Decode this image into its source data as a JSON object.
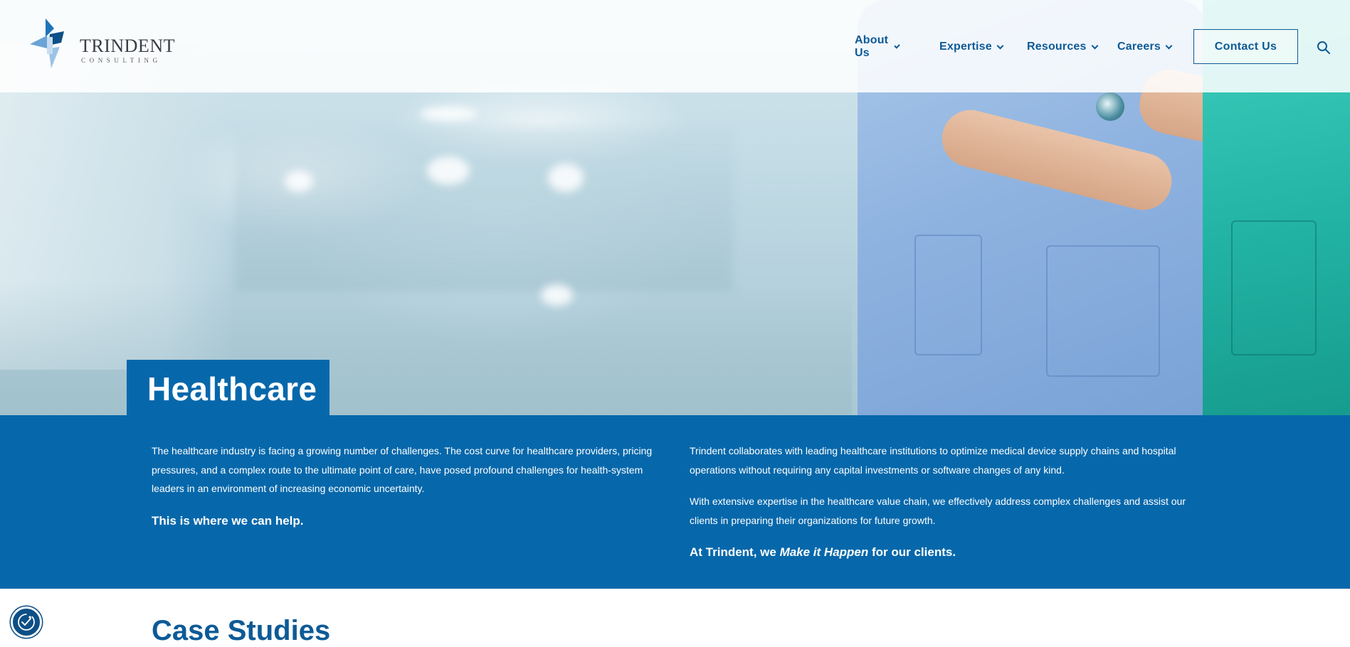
{
  "brand": {
    "name": "TRINDENT",
    "tagline": "CONSULTING",
    "primary_color": "#0668ab",
    "nav_color": "#0d5a96"
  },
  "nav": {
    "items": [
      {
        "label": "About Us",
        "icon": "chevron-down-icon"
      },
      {
        "label": "Expertise",
        "icon": "chevron-down-icon"
      },
      {
        "label": "Resources",
        "icon": "chevron-down-icon"
      },
      {
        "label": "Careers",
        "icon": "chevron-down-icon"
      }
    ],
    "contact_label": "Contact Us",
    "search_icon": "search-icon"
  },
  "hero": {
    "title": "Healthcare"
  },
  "intro": {
    "left_paragraph": "The healthcare industry is facing a growing number of challenges. The cost curve for healthcare providers, pricing pressures, and a complex route to the ultimate point of care, have posed profound challenges for health-system leaders in an environment of increasing economic uncertainty.",
    "left_lead": "This is where we can help.",
    "right_paragraph_1": "Trindent collaborates with leading healthcare institutions to optimize medical device supply chains and hospital operations without requiring any capital investments or software changes of any kind.",
    "right_paragraph_2": "With extensive expertise in the healthcare value chain, we effectively address complex challenges and assist our clients in preparing their organizations for future growth.",
    "right_lead_prefix": "At Trindent, we ",
    "right_lead_emphasis": "Make it Happen",
    "right_lead_suffix": " for our clients."
  },
  "case_studies": {
    "title": "Case Studies"
  },
  "accessibility": {
    "icon": "accessibility-icon"
  }
}
